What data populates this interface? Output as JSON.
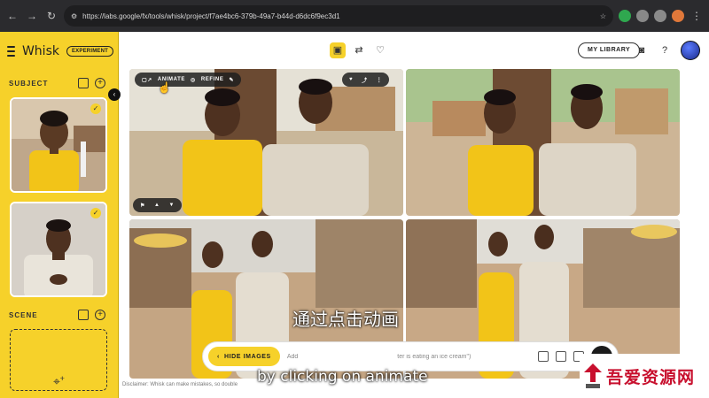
{
  "browser": {
    "url": "https://labs.google/fx/tools/whisk/project/f7ae4bc6-379b-49a7-b44d-d6dc6f9ec3d1"
  },
  "sidebar": {
    "brand": "Whisk",
    "badge": "EXPERIMENT",
    "subject_label": "SUBJECT",
    "scene_label": "SCENE"
  },
  "header": {
    "library_label": "MY LIBRARY"
  },
  "image_overlay": {
    "animate_label": "ANIMATE",
    "refine_label": "REFINE"
  },
  "prompt_bar": {
    "hide_images_label": "HIDE IMAGES",
    "placeholder_fragment": "Add",
    "placeholder_tail": "ter is eating an ice cream\")"
  },
  "disclaimer": "Disclaimer: Whisk can make mistakes, so double",
  "subtitles": {
    "chinese": "通过点击动画",
    "english": "by clicking on animate"
  },
  "watermark": {
    "text": "吾爱资源网"
  },
  "colors": {
    "accent_yellow": "#f6d12a",
    "dark": "#1b1b1b",
    "watermark_red": "#c8102e"
  }
}
